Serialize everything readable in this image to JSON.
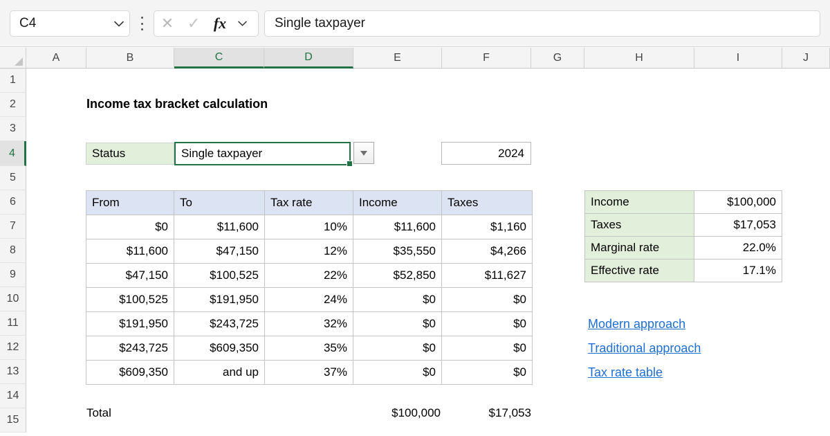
{
  "formula_bar": {
    "name_box_value": "C4",
    "cancel_icon": "close-icon",
    "enter_icon": "check-icon",
    "fx_label": "fx",
    "formula_value": "Single taxpayer"
  },
  "columns": [
    "A",
    "B",
    "C",
    "D",
    "E",
    "F",
    "G",
    "H",
    "I",
    "J"
  ],
  "selected_columns": [
    "C",
    "D"
  ],
  "rows": [
    "1",
    "2",
    "3",
    "4",
    "5",
    "6",
    "7",
    "8",
    "9",
    "10",
    "11",
    "12",
    "13",
    "14",
    "15"
  ],
  "selected_row": "4",
  "sheet": {
    "title": "Income tax bracket calculation",
    "status_label": "Status",
    "status_value": "Single taxpayer",
    "year": "2024",
    "total_label": "Total",
    "total_income": "$100,000",
    "total_taxes": "$17,053"
  },
  "bracket_table": {
    "headers": [
      "From",
      "To",
      "Tax rate",
      "Income",
      "Taxes"
    ],
    "rows": [
      [
        "$0",
        "$11,600",
        "10%",
        "$11,600",
        "$1,160"
      ],
      [
        "$11,600",
        "$47,150",
        "12%",
        "$35,550",
        "$4,266"
      ],
      [
        "$47,150",
        "$100,525",
        "22%",
        "$52,850",
        "$11,627"
      ],
      [
        "$100,525",
        "$191,950",
        "24%",
        "$0",
        "$0"
      ],
      [
        "$191,950",
        "$243,725",
        "32%",
        "$0",
        "$0"
      ],
      [
        "$243,725",
        "$609,350",
        "35%",
        "$0",
        "$0"
      ],
      [
        "$609,350",
        "and up",
        "37%",
        "$0",
        "$0"
      ]
    ]
  },
  "summary": {
    "rows": [
      {
        "label": "Income",
        "value": "$100,000"
      },
      {
        "label": "Taxes",
        "value": "$17,053"
      },
      {
        "label": "Marginal rate",
        "value": "22.0%"
      },
      {
        "label": "Effective rate",
        "value": "17.1%"
      }
    ]
  },
  "links": [
    "Modern approach",
    "Traditional approach",
    "Tax rate table"
  ],
  "colors": {
    "excel_green": "#217346",
    "header_fill": "#dce3f2",
    "green_fill": "#e2efda",
    "link_blue": "#1f6fd0"
  }
}
